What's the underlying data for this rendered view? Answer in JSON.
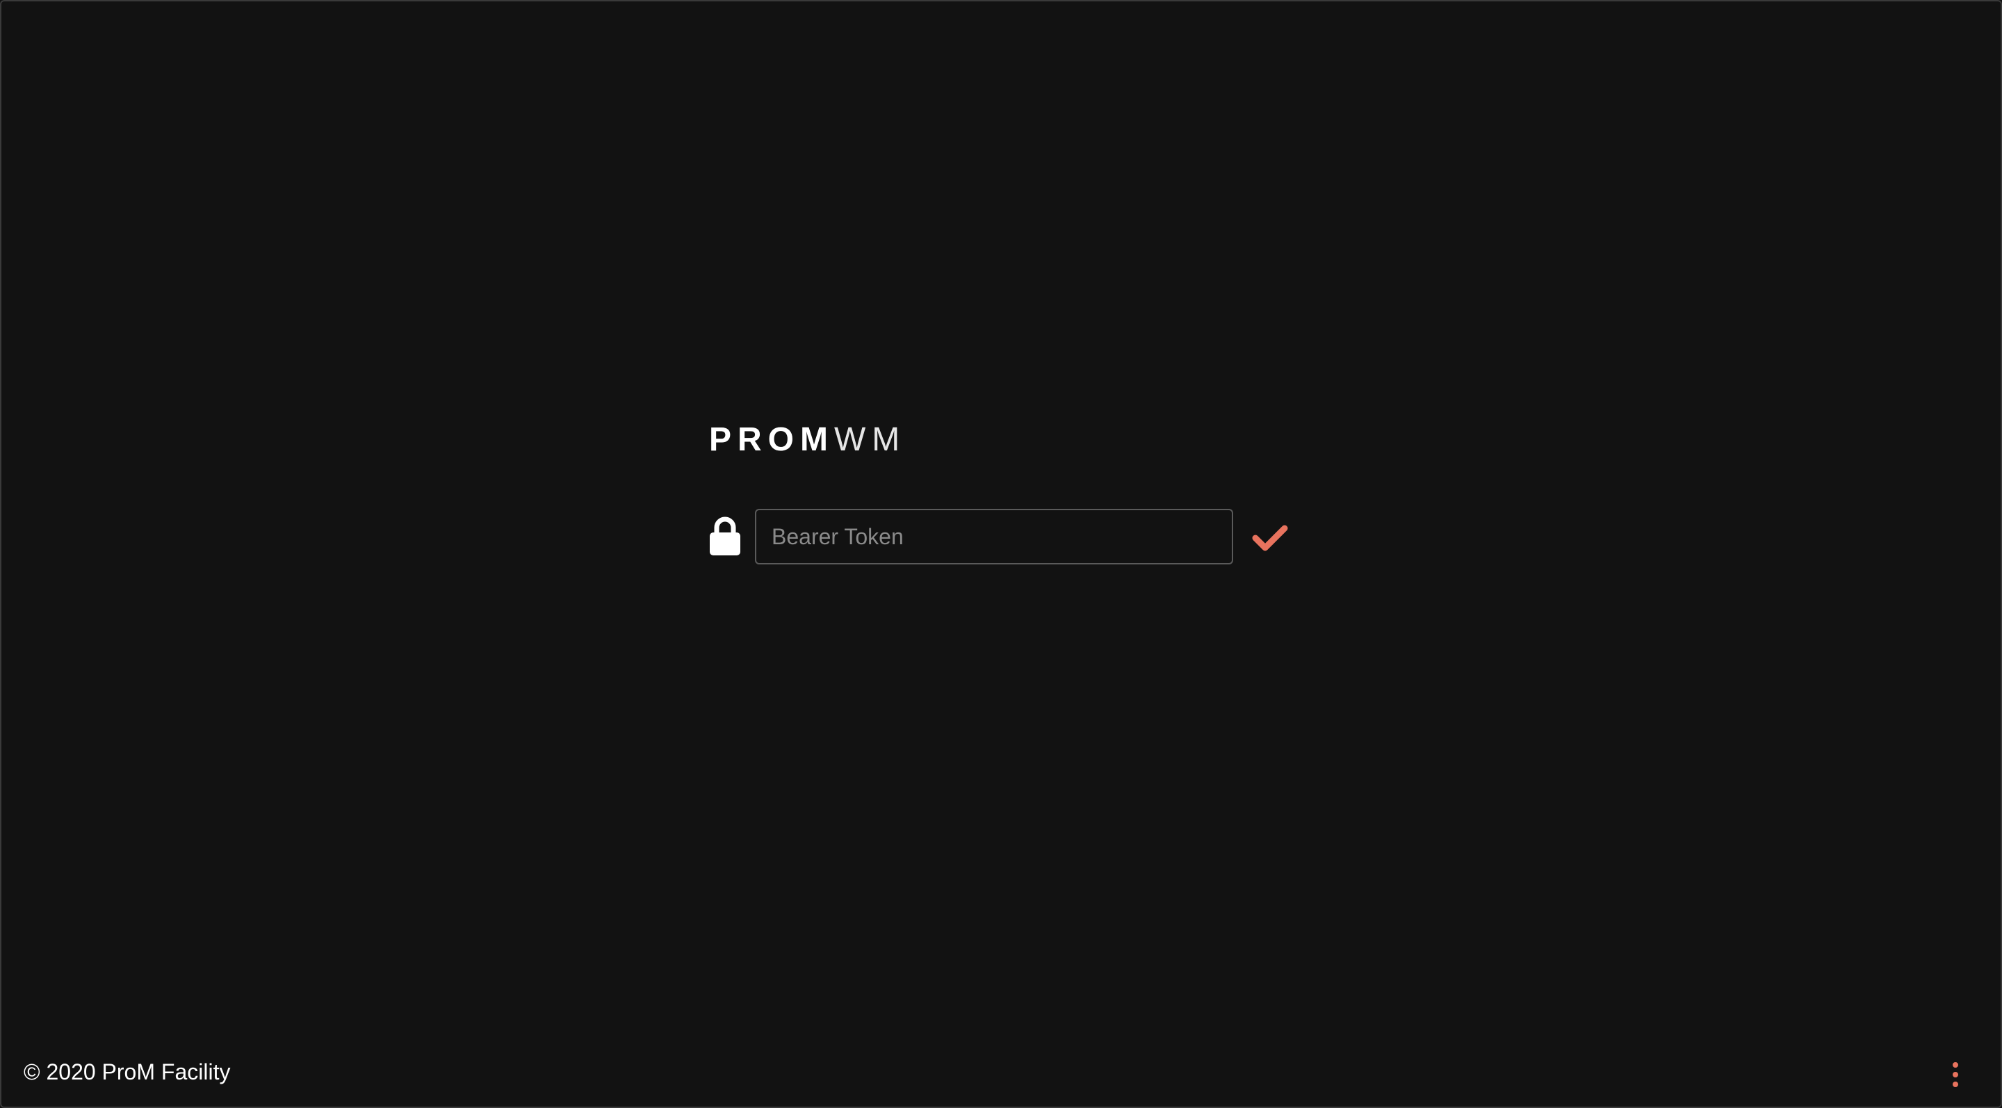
{
  "brand": {
    "name_bold": "PROM",
    "name_light": "WM"
  },
  "login": {
    "lock_icon": "lock-icon",
    "token_placeholder": "Bearer Token",
    "token_value": "",
    "submit_icon": "checkmark-icon"
  },
  "footer": {
    "copyright": "© 2020 ProM Facility",
    "menu_icon": "more-vertical-icon"
  },
  "colors": {
    "background": "#121212",
    "accent": "#e8735e",
    "text": "#ffffff",
    "input_border": "#5a5a5a"
  }
}
